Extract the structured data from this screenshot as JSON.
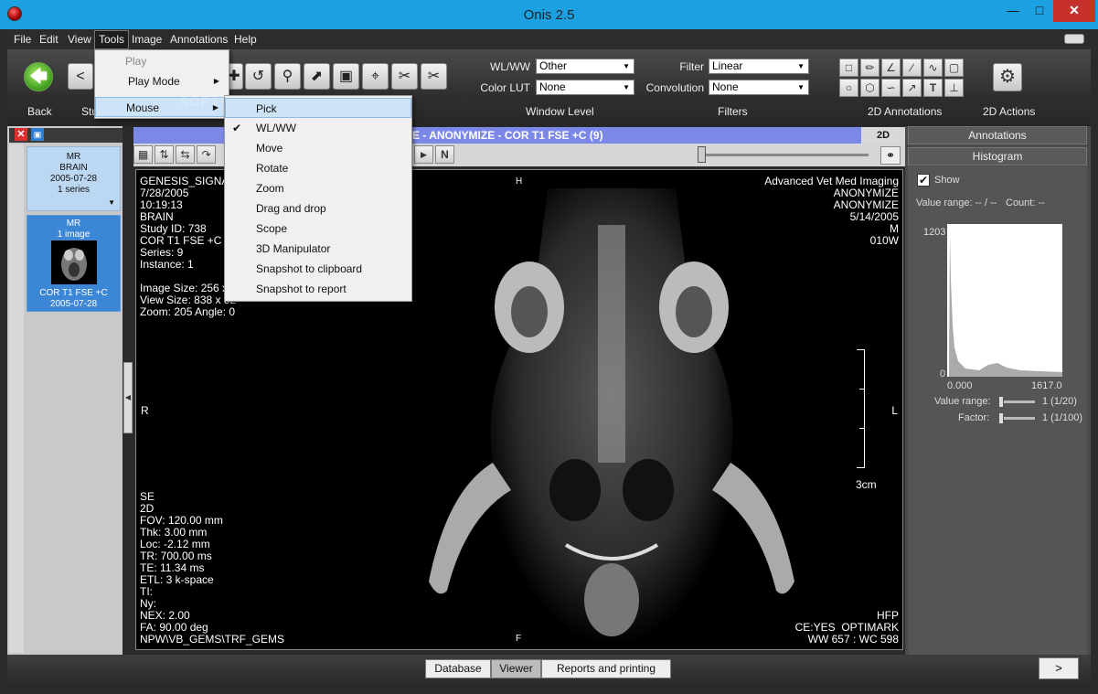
{
  "app": {
    "title": "Onis 2.5"
  },
  "window": {
    "minimize": "—",
    "maximize": "□",
    "close": "✕"
  },
  "menu": [
    "File",
    "Edit",
    "View",
    "Tools",
    "Image",
    "Annotations",
    "Help"
  ],
  "toolbar": {
    "back_label": "Back",
    "studies_label": "Stu",
    "nav_prev": "<",
    "window_level_label": "Window Level",
    "filters_label": "Filters",
    "annotations_label": "2D Annotations",
    "actions_label": "2D Actions",
    "wlww_label": "WL/WW",
    "wlww_value": "Other",
    "colorlut_label": "Color LUT",
    "colorlut_value": "None",
    "filter_label": "Filter",
    "filter_value": "Linear",
    "convolution_label": "Convolution",
    "convolution_value": "None"
  },
  "tools_menu": {
    "play": "Play",
    "play_mode": "Play Mode",
    "mouse": "Mouse"
  },
  "mouse_menu": {
    "items": [
      "Pick",
      "WL/WW",
      "Move",
      "Rotate",
      "Zoom",
      "Drag and drop",
      "Scope",
      "3D Manipulator",
      "Snapshot to clipboard",
      "Snapshot to report"
    ],
    "checked": "WL/WW"
  },
  "watermark": "SOFTPEDIA",
  "studies": [
    {
      "modality": "MR",
      "description": "BRAIN",
      "date": "2005-07-28",
      "count": "1 series"
    },
    {
      "modality": "MR",
      "count": "1 image",
      "description": "COR T1 FSE +C",
      "date": "2005-07-28"
    }
  ],
  "viewer": {
    "header": "E - ANONYMIZE - COR T1 FSE +C (9)",
    "mode": "2D",
    "top_left": "GENESIS_SIGNA\n7/28/2005\n10:19:13\nBRAIN\nStudy ID: 738\nCOR T1 FSE +C\nSeries: 9\nInstance: 1\n\nImage Size: 256 x 2\nView Size: 838 x 52\nZoom: 205 Angle: 0",
    "top_right": "Advanced Vet Med Imaging\nANONYMIZE\nANONYMIZE\n5/14/2005\nM\n010W",
    "bottom_left": "SE\n2D\nFOV: 120.00 mm\nThk: 3.00 mm\nLoc: -2.12 mm\nTR: 700.00 ms\nTE: 11.34 ms\nETL: 3 k-space\nTI:\nNy:\nNEX: 2.00\nFA: 90.00 deg\nNPW\\VB_GEMS\\TRF_GEMS",
    "bottom_right": "HFP\nCE:YES  OPTIMARK\nWW 657 : WC 598",
    "orient_top": "H",
    "orient_bottom": "F",
    "orient_left": "R",
    "orient_right": "L",
    "scale": "3cm"
  },
  "right_panel": {
    "annotations": "Annotations",
    "histogram": "Histogram",
    "show": "Show",
    "value_range": "Value range: -- / --",
    "count": "Count: --",
    "y_max": "1203",
    "y_min": "0",
    "x_min": "0.000",
    "x_max": "1617.0",
    "vr_label": "Value range:",
    "vr_value": "1 (1/20)",
    "factor_label": "Factor:",
    "factor_value": "1 (1/100)"
  },
  "bottom_tabs": [
    "Database",
    "Viewer",
    "Reports and printing"
  ],
  "next": ">",
  "colors": {
    "titlebar": "#1ba1e2",
    "viewer_header": "#7b88e8",
    "selected_study": "#3c86d6",
    "close_button": "#c7312c"
  }
}
